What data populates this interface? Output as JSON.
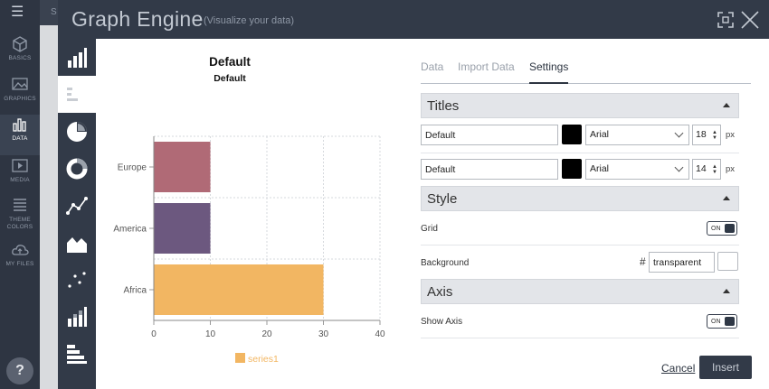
{
  "app_sidebar": {
    "items": [
      {
        "label": "BASICS",
        "icon": "cube-icon"
      },
      {
        "label": "GRAPHICS",
        "icon": "graphics-icon"
      },
      {
        "label": "DATA",
        "icon": "data-chart-icon",
        "active": true
      },
      {
        "label": "MEDIA",
        "icon": "media-play-icon"
      },
      {
        "label": "THEME COLORS",
        "icon": "theme-colors-icon"
      },
      {
        "label": "MY FILES",
        "icon": "cloud-upload-icon"
      }
    ],
    "help_label": "?"
  },
  "modal": {
    "title": "Graph Engine",
    "subtitle": "(Visualize your data)"
  },
  "chart_types": [
    "vertical-bar-icon",
    "horizontal-bar-icon",
    "pie-icon",
    "donut-icon",
    "line-icon",
    "area-icon",
    "scatter-icon",
    "stacked-bar-icon",
    "stacked-horizontal-bar-icon"
  ],
  "chart_data": {
    "type": "bar",
    "orientation": "horizontal",
    "title": "Default",
    "subtitle": "Default",
    "categories": [
      "Europe",
      "America",
      "Africa"
    ],
    "values": [
      10,
      10,
      30
    ],
    "bar_colors": [
      "#b06a76",
      "#6c587f",
      "#f2b662"
    ],
    "xlim": [
      0,
      40
    ],
    "x_ticks": [
      "0",
      "10",
      "20",
      "30",
      "40"
    ],
    "grid": true,
    "legend": {
      "position": "bottom",
      "entries": [
        {
          "name": "series1",
          "color": "#f2b662"
        }
      ]
    }
  },
  "settings": {
    "tabs": [
      "Data",
      "Import Data",
      "Settings"
    ],
    "active_tab": "Settings",
    "titles": {
      "heading": "Titles",
      "rows": [
        {
          "text": "Default",
          "color": "#000000",
          "font": "Arial",
          "size": "18",
          "unit": "px"
        },
        {
          "text": "Default",
          "color": "#000000",
          "font": "Arial",
          "size": "14",
          "unit": "px"
        }
      ]
    },
    "style": {
      "heading": "Style",
      "grid_label": "Grid",
      "grid_toggle": "ON",
      "background_label": "Background",
      "hash": "#",
      "background_value": "transparent"
    },
    "axis": {
      "heading": "Axis",
      "show_axis_label": "Show Axis",
      "show_axis_toggle": "ON"
    }
  },
  "footer": {
    "cancel_label": "Cancel",
    "insert_label": "Insert"
  }
}
